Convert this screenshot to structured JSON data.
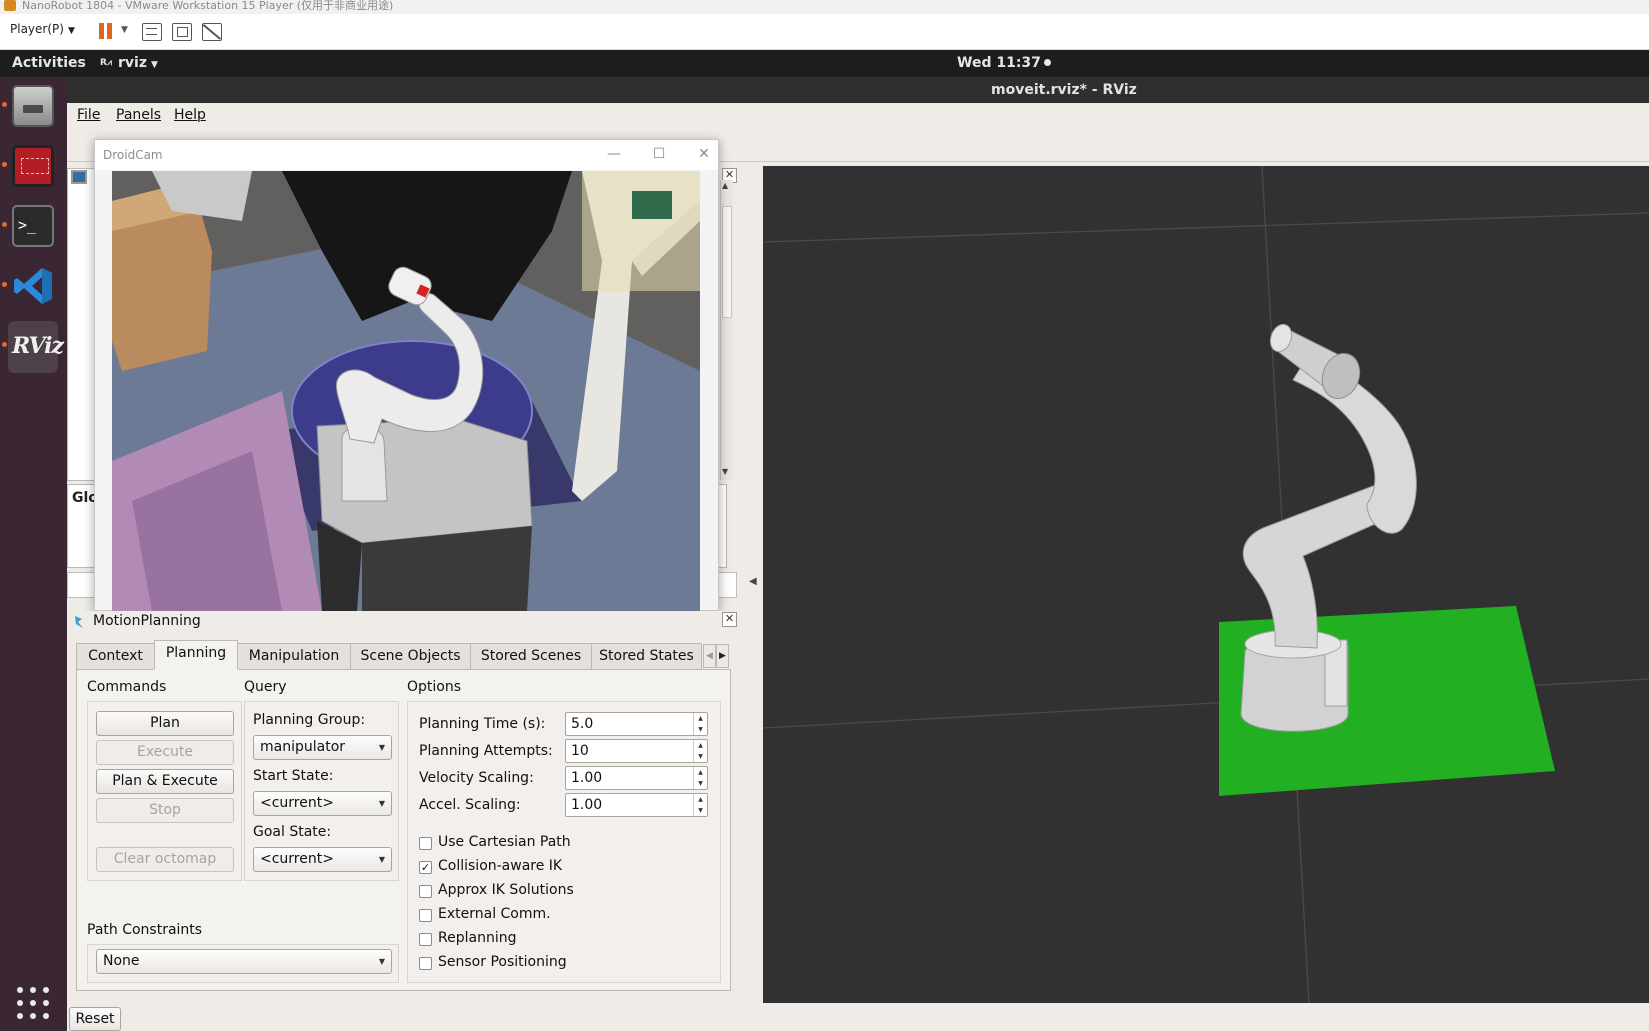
{
  "vmware": {
    "title": "NanoRobot 1804 - VMware Workstation 15 Player (仅用于非商业用途)",
    "player_menu": "Player(P)"
  },
  "topbar": {
    "activities": "Activities",
    "app_name": "rviz",
    "clock": "Wed 11:37"
  },
  "dock": {
    "items": [
      "files-icon",
      "system-monitor-icon",
      "terminal-icon",
      "vscode-icon",
      "rviz-icon"
    ],
    "terminal_glyph": ">_",
    "rviz_glyph": "RViz"
  },
  "rviz": {
    "window_title": "moveit.rviz* - RViz",
    "menu": [
      "File",
      "Panels",
      "Help"
    ],
    "global_options_label": "Glo"
  },
  "droidcam": {
    "title": "DroidCam"
  },
  "motion_planning": {
    "title": "MotionPlanning",
    "tabs": [
      "Context",
      "Planning",
      "Manipulation",
      "Scene Objects",
      "Stored Scenes",
      "Stored States"
    ],
    "active_tab": "Planning",
    "commands": {
      "title": "Commands",
      "plan": "Plan",
      "execute": "Execute",
      "plan_execute": "Plan & Execute",
      "stop": "Stop",
      "clear_octomap": "Clear octomap"
    },
    "query": {
      "title": "Query",
      "planning_group_label": "Planning Group:",
      "planning_group_value": "manipulator",
      "start_state_label": "Start State:",
      "start_state_value": "<current>",
      "goal_state_label": "Goal State:",
      "goal_state_value": "<current>"
    },
    "options": {
      "title": "Options",
      "planning_time_label": "Planning Time (s):",
      "planning_time_value": "5.0",
      "planning_attempts_label": "Planning Attempts:",
      "planning_attempts_value": "10",
      "velocity_scaling_label": "Velocity Scaling:",
      "velocity_scaling_value": "1.00",
      "accel_scaling_label": "Accel. Scaling:",
      "accel_scaling_value": "1.00",
      "checkboxes": [
        {
          "label": "Use Cartesian Path",
          "checked": false
        },
        {
          "label": "Collision-aware IK",
          "checked": true
        },
        {
          "label": "Approx IK Solutions",
          "checked": false
        },
        {
          "label": "External Comm.",
          "checked": false
        },
        {
          "label": "Replanning",
          "checked": false
        },
        {
          "label": "Sensor Positioning",
          "checked": false
        }
      ]
    },
    "path_constraints": {
      "title": "Path Constraints",
      "value": "None"
    }
  },
  "footer": {
    "reset": "Reset"
  },
  "colors": {
    "viewport_bg": "#313131",
    "ground_plane": "#22b022",
    "robot": "#d8d8d8",
    "accent_orange": "#e0661b"
  }
}
